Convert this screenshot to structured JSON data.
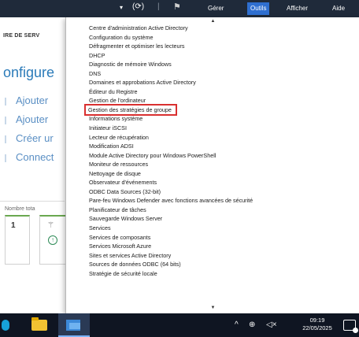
{
  "toolbar": {
    "refresh_icon": "refresh-icon",
    "flag_icon": "flag-icon",
    "menu": [
      {
        "label": "Gérer"
      },
      {
        "label": "Outils"
      },
      {
        "label": "Afficher"
      },
      {
        "label": "Aide"
      }
    ],
    "active_menu": "Outils",
    "accent": "#2f6fd0"
  },
  "background": {
    "header": "IRE DE SERV",
    "title": "onfigure",
    "links": [
      "Ajouter",
      "Ajouter",
      "Créer ur",
      "Connect"
    ],
    "count_label": "Nombre tota",
    "tile_number": "1"
  },
  "dropdown": {
    "items": [
      "Centre d'administration Active Directory",
      "Configuration du système",
      "Défragmenter et optimiser les lecteurs",
      "DHCP",
      "Diagnostic de mémoire Windows",
      "DNS",
      "Domaines et approbations Active Directory",
      "Éditeur du Registre",
      "Gestion de l'ordinateur",
      "Gestion des stratégies de groupe",
      "Informations système",
      "Initiateur iSCSI",
      "Lecteur de récupération",
      "Modification ADSI",
      "Module Active Directory pour Windows PowerShell",
      "Moniteur de ressources",
      "Nettoyage de disque",
      "Observateur d'événements",
      "ODBC Data Sources (32-bit)",
      "Pare-feu Windows Defender avec fonctions avancées de sécurité",
      "Planificateur de tâches",
      "Sauvegarde Windows Server",
      "Services",
      "Services de composants",
      "Services Microsoft Azure",
      "Sites et services Active Directory",
      "Sources de données ODBC (64 bits)",
      "Stratégie de sécurité locale"
    ],
    "highlighted_item": "Gestion des stratégies de groupe",
    "highlight_color": "#d93030"
  },
  "taskbar": {
    "time": "09:19",
    "date": "22/05/2025"
  }
}
